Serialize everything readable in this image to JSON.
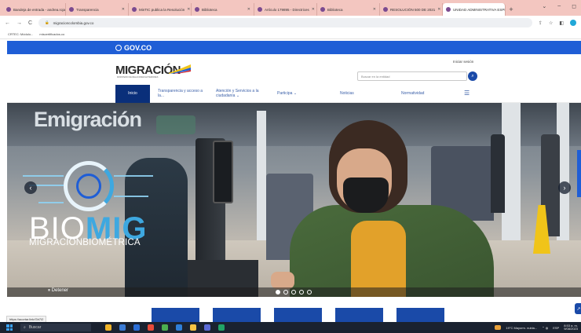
{
  "browser": {
    "tabs": [
      {
        "label": "Bandeja de entrada - andrea.rojas",
        "active": false
      },
      {
        "label": "Transparencia",
        "active": false
      },
      {
        "label": "MinTIC publica la Resolución",
        "active": false
      },
      {
        "label": "Biblioteca",
        "active": false
      },
      {
        "label": "Artículo 179895 - Directrices",
        "active": false
      },
      {
        "label": "Biblioteca",
        "active": false
      },
      {
        "label": "RESOLUCIÓN 500 DE 2021",
        "active": false
      },
      {
        "label": "UNIDAD ADMINISTRATIVA ESPECIAL",
        "active": true
      }
    ],
    "new_tab": "+",
    "window_controls": [
      "⌄",
      "–",
      "◻"
    ],
    "url": "migracioncolombia.gov.co",
    "bookmarks": [
      "CRTEC: Módulo...",
      "miscertificados.co"
    ]
  },
  "gov_bar": {
    "label": "GOV.CO"
  },
  "header": {
    "logo": "MIGRACIÓN",
    "logo_sub": "MINISTERIO DE RELACIONES EXTERIORES",
    "login": "Iniciar sesión",
    "search_placeholder": "Buscar en la entidad"
  },
  "nav": [
    {
      "label": "Inicio",
      "active": true
    },
    {
      "label": "Transparencia y acceso a la...",
      "active": false
    },
    {
      "label": "Atención y Servicios a la ciudadanía ⌄",
      "active": false
    },
    {
      "label": "Participa ⌄",
      "active": false
    },
    {
      "label": "Noticias",
      "active": false
    },
    {
      "label": "Normatividad",
      "active": false
    },
    {
      "label": "☰",
      "active": false
    }
  ],
  "hero": {
    "sign": "Emigración",
    "brand_bio": "BIO",
    "brand_mig": "MIG",
    "brand_sub": "MIGRACIÓNBIOMÉTRICA",
    "stop_label": "⏸ Detener",
    "slide_count": 5,
    "active_slide": 1,
    "prev": "‹",
    "next": "›"
  },
  "status_url": "https://acortar.link/Gb7I2",
  "taskbar": {
    "search": "Buscar",
    "weather": "19°C Mayorm. nubla...",
    "lang": "ESP",
    "time": "8:53 a. m.",
    "date": "9/08/2023"
  },
  "colors": {
    "brand_blue": "#1f5ed6",
    "nav_active": "#0a2f7a",
    "accent_cyan": "#3ea8e0"
  }
}
